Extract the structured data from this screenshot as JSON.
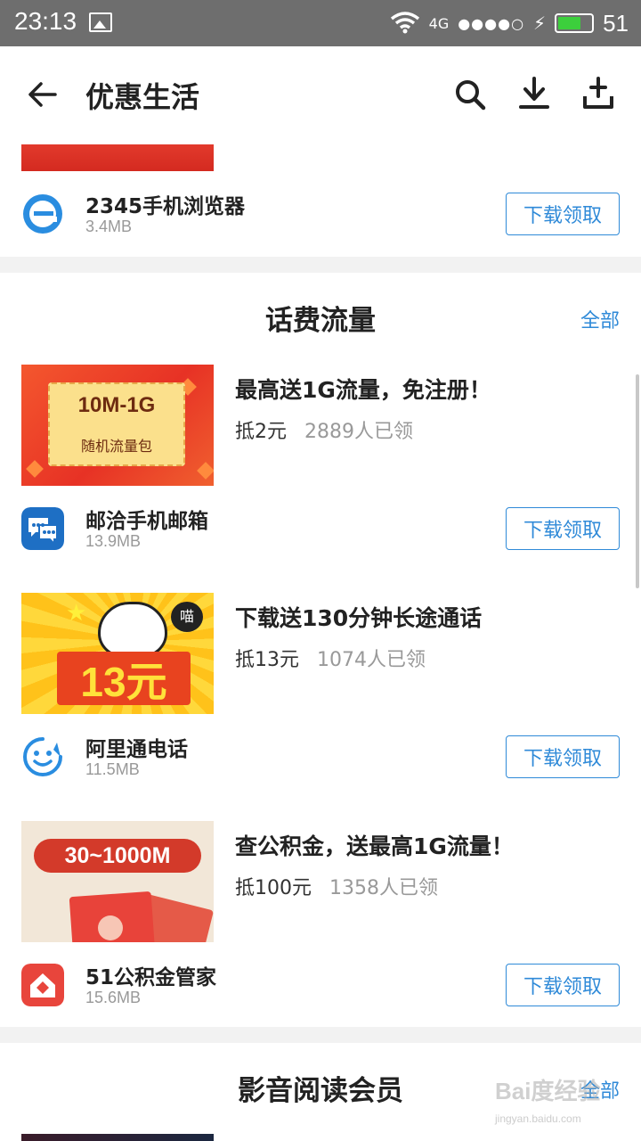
{
  "status_bar": {
    "time": "23:13",
    "network": "4G",
    "signal": "●●●●○",
    "battery_level": "51"
  },
  "app_bar": {
    "title": "优惠生活",
    "icons": [
      "back-arrow-icon",
      "search-icon",
      "download-icon",
      "share-upload-icon"
    ]
  },
  "top_item": {
    "app_name": "2345手机浏览器",
    "app_size": "3.4MB",
    "button": "下载领取"
  },
  "section_traffic": {
    "title": "话费流量",
    "all_link": "全部",
    "items": [
      {
        "promo_title": "最高送1G流量，免注册！",
        "value": "抵2元",
        "claimed": "2889人已领",
        "banner_text_1": "10M-1G",
        "banner_text_2": "随机流量包",
        "app_name": "邮洽手机邮箱",
        "app_size": "13.9MB",
        "button": "下载领取"
      },
      {
        "promo_title": "下载送130分钟长途通话",
        "value": "抵13元",
        "claimed": "1074人已领",
        "banner_text_1": "13元",
        "banner_text_2": "喵",
        "app_name": "阿里通电话",
        "app_size": "11.5MB",
        "button": "下载领取"
      },
      {
        "promo_title": "查公积金，送最高1G流量！",
        "value": "抵100元",
        "claimed": "1358人已领",
        "banner_text_1": "30~1000M",
        "app_name": "51公积金管家",
        "app_size": "15.6MB",
        "button": "下载领取"
      }
    ]
  },
  "section_media": {
    "title": "影音阅读会员",
    "all_link": "全部"
  },
  "watermark": {
    "text": "Bai度经验",
    "sub": "jingyan.baidu.com"
  },
  "colors": {
    "accent": "#2f8ad8",
    "status_bar": "#6e6e6e"
  }
}
